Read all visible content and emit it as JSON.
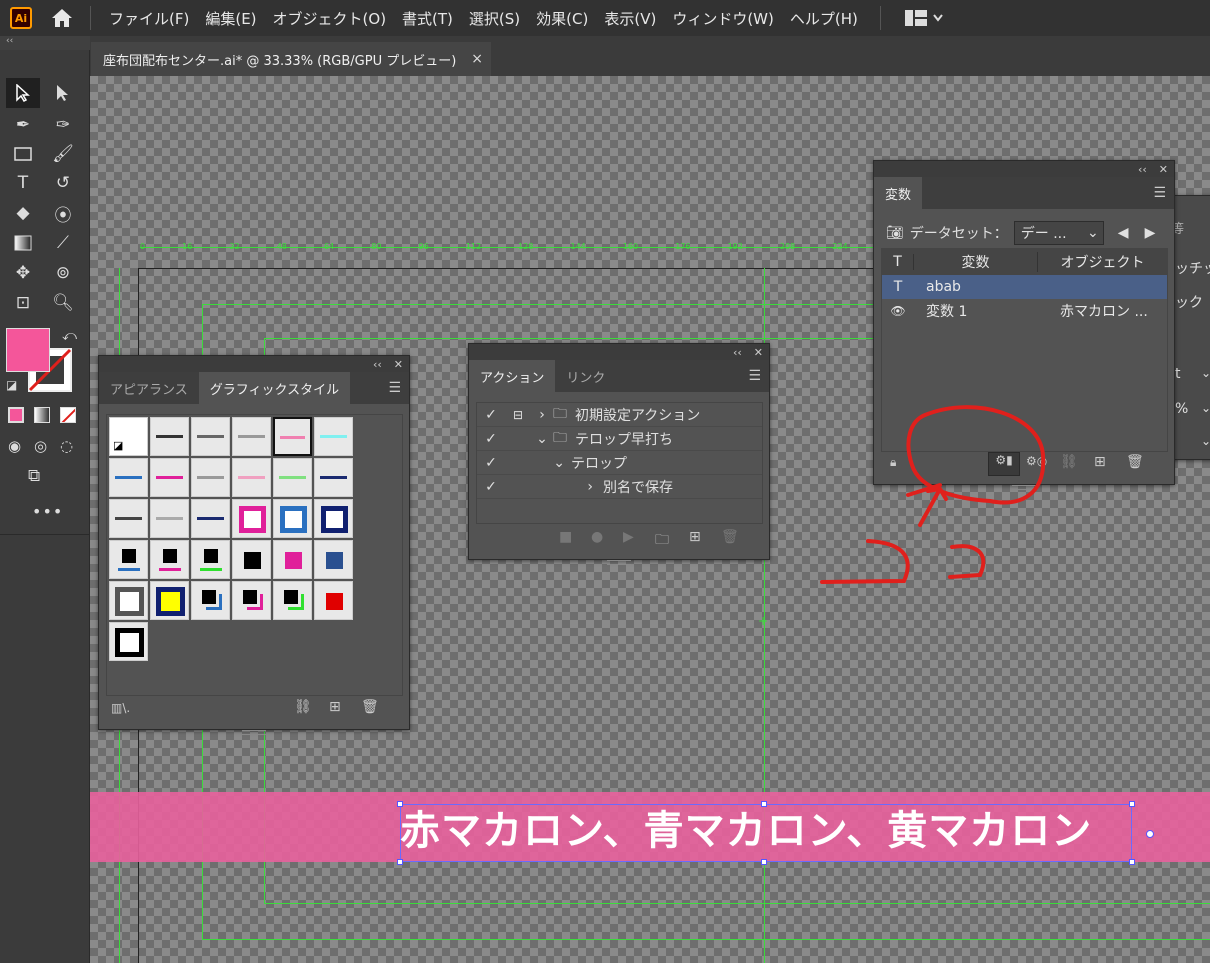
{
  "app": {
    "logo": "Ai"
  },
  "menu": [
    "ファイル(F)",
    "編集(E)",
    "オブジェクト(O)",
    "書式(T)",
    "選択(S)",
    "効果(C)",
    "表示(V)",
    "ウィンドウ(W)",
    "ヘルプ(H)"
  ],
  "document_tab": {
    "title": "座布団配布センター.ai* @ 33.33% (RGB/GPU プレビュー)",
    "close": "×"
  },
  "colors": {
    "fill": "#f4569a",
    "accent_red": "#e0201c",
    "guide": "#3bdc3b"
  },
  "appearance_panel": {
    "tabs": [
      "アピアランス",
      "グラフィックスタイル"
    ],
    "active_tab": "グラフィックスタイル"
  },
  "actions_panel": {
    "tabs": [
      "アクション",
      "リンク"
    ],
    "rows": [
      {
        "label": "初期設定アクション",
        "type": "set"
      },
      {
        "label": "テロップ早打ち",
        "type": "set"
      },
      {
        "label": "テロップ",
        "type": "action"
      },
      {
        "label": "別名で保存",
        "type": "step"
      }
    ]
  },
  "variables_panel": {
    "tab": "変数",
    "dataset_label": "データセット：",
    "dataset_value": "デー ...",
    "columns": [
      "変数",
      "オブジェクト"
    ],
    "rows": [
      {
        "type_icon": "T",
        "name": "abab",
        "object": ""
      },
      {
        "type_icon": "eye-icon",
        "name": "変数 1",
        "object": "赤マカロン ..."
      }
    ]
  },
  "behind_panel": {
    "labels": [
      "ッチッ",
      "ック",
      "t",
      "%"
    ],
    "tab_glyph": "等"
  },
  "artwork": {
    "text": "赤マカロン、青マカロン、黄マカロン"
  },
  "ruler_marks": [
    "0",
    "16",
    "32",
    "48",
    "64",
    "80",
    "96",
    "112",
    "128",
    "144",
    "160",
    "176",
    "192",
    "208",
    "224",
    "240"
  ]
}
